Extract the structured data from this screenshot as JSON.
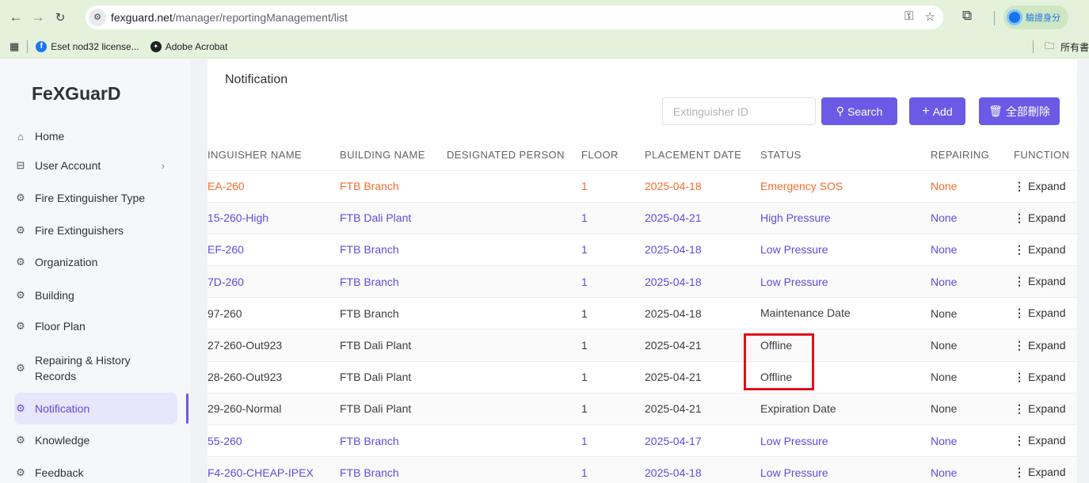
{
  "browser": {
    "url_host": "fexguard.net",
    "url_path": "/manager/reportingManagement/list",
    "profile_label": "驗證身分",
    "bookmarks": [
      {
        "label": "Eset nod32 license..."
      },
      {
        "label": "Adobe Acrobat"
      }
    ],
    "bookmarks_right": "所有書"
  },
  "sidebar": {
    "logo": "FeXGuarD",
    "items": [
      {
        "label": "Home",
        "icon": "home-icon"
      },
      {
        "label": "User Account",
        "icon": "table-icon"
      },
      {
        "label": "Fire Extinguisher Type",
        "icon": "gear-icon"
      },
      {
        "label": "Fire Extinguishers",
        "icon": "gear-icon"
      },
      {
        "label": "Organization",
        "icon": "gear-icon"
      },
      {
        "label": "Building",
        "icon": "gear-icon"
      },
      {
        "label": "Floor Plan",
        "icon": "gear-icon"
      },
      {
        "label": "Repairing & History",
        "label2": "Records",
        "icon": "gear-icon"
      },
      {
        "label": "Notification",
        "icon": "gear-icon"
      },
      {
        "label": "Knowledge",
        "icon": "gear-icon"
      },
      {
        "label": "Feedback",
        "icon": "gear-icon"
      }
    ]
  },
  "page": {
    "title": "Notification",
    "search_placeholder": "Extinguisher ID",
    "search_label": "Search",
    "add_label": "Add",
    "delete_all_label": "全部刪除"
  },
  "table": {
    "columns": [
      "INGUISHER NAME",
      "BUILDING NAME",
      "DESIGNATED PERSON",
      "FLOOR",
      "PLACEMENT DATE",
      "STATUS",
      "REPAIRING",
      "FUNCTION"
    ],
    "function_label": "Expand",
    "rows": [
      {
        "name": "EA-260",
        "building": "FTB Branch",
        "person": "",
        "floor": "1",
        "date": "2025-04-18",
        "status": "Emergency SOS",
        "repairing": "None",
        "tone": "red"
      },
      {
        "name": "15-260-High",
        "building": "FTB Dali Plant",
        "person": "",
        "floor": "1",
        "date": "2025-04-21",
        "status": "High Pressure",
        "repairing": "None",
        "tone": "blue"
      },
      {
        "name": "EF-260",
        "building": "FTB Branch",
        "person": "",
        "floor": "1",
        "date": "2025-04-18",
        "status": "Low Pressure",
        "repairing": "None",
        "tone": "blue"
      },
      {
        "name": "7D-260",
        "building": "FTB Branch",
        "person": "",
        "floor": "1",
        "date": "2025-04-18",
        "status": "Low Pressure",
        "repairing": "None",
        "tone": "blue"
      },
      {
        "name": "97-260",
        "building": "FTB Branch",
        "person": "",
        "floor": "1",
        "date": "2025-04-18",
        "status": "Maintenance Date",
        "repairing": "None",
        "tone": "gray"
      },
      {
        "name": "27-260-Out923",
        "building": "FTB Dali Plant",
        "person": "",
        "floor": "1",
        "date": "2025-04-21",
        "status": "Offline",
        "repairing": "None",
        "tone": "gray"
      },
      {
        "name": "28-260-Out923",
        "building": "FTB Dali Plant",
        "person": "",
        "floor": "1",
        "date": "2025-04-21",
        "status": "Offline",
        "repairing": "None",
        "tone": "gray"
      },
      {
        "name": "29-260-Normal",
        "building": "FTB Dali Plant",
        "person": "",
        "floor": "1",
        "date": "2025-04-21",
        "status": "Expiration Date",
        "repairing": "None",
        "tone": "gray"
      },
      {
        "name": "55-260",
        "building": "FTB Branch",
        "person": "",
        "floor": "1",
        "date": "2025-04-17",
        "status": "Low Pressure",
        "repairing": "None",
        "tone": "blue"
      },
      {
        "name": "F4-260-CHEAP-IPEX",
        "building": "FTB Branch",
        "person": "",
        "floor": "1",
        "date": "2025-04-18",
        "status": "Low Pressure",
        "repairing": "None",
        "tone": "blue"
      }
    ]
  },
  "colors": {
    "accent": "#6a5ae6",
    "alert": "#f56c2c",
    "link": "#5a4de0",
    "highlight_box": "#e0101a"
  }
}
